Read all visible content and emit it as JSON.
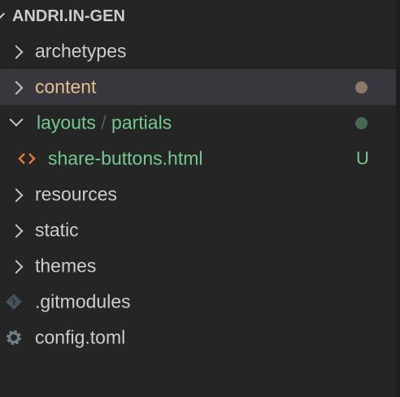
{
  "explorer": {
    "root_title": "ANDRI.IN-GEN",
    "items": [
      {
        "label": "archetypes",
        "type": "folder",
        "expanded": false
      },
      {
        "label": "content",
        "type": "folder",
        "expanded": false,
        "selected": true,
        "status": "modified-dot",
        "color": "#e2c08d",
        "dot_color": "#8a7b64"
      },
      {
        "label": "layouts",
        "separator": "/",
        "label2": "partials",
        "type": "folder",
        "expanded": true,
        "status": "untracked-dot",
        "color": "#73c991",
        "dot_color": "#46694f"
      },
      {
        "label": "share-buttons.html",
        "type": "file",
        "icon": "html-code-icon",
        "badge": "U",
        "color": "#73c991"
      },
      {
        "label": "resources",
        "type": "folder",
        "expanded": false
      },
      {
        "label": "static",
        "type": "folder",
        "expanded": false
      },
      {
        "label": "themes",
        "type": "folder",
        "expanded": false
      },
      {
        "label": ".gitmodules",
        "type": "file",
        "icon": "git-icon"
      },
      {
        "label": "config.toml",
        "type": "file",
        "icon": "gear-icon"
      }
    ]
  }
}
